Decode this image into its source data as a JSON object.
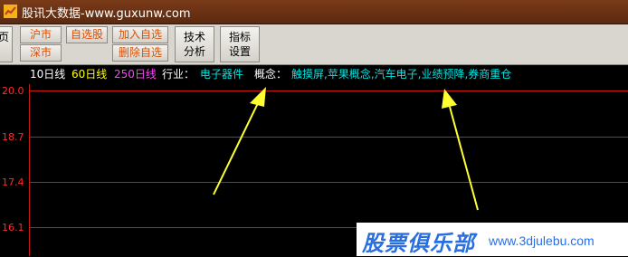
{
  "titlebar": {
    "title": "股讯大数据-www.guxunw.com"
  },
  "toolbar": {
    "page_btn": "页",
    "hushi": "沪市",
    "shenshi": "深市",
    "zixuangu": "自选股",
    "add_fav": "加入自选",
    "del_fav": "删除自选",
    "tech_analysis": [
      "技术",
      "分析"
    ],
    "indicator_settings": [
      "指标",
      "设置"
    ]
  },
  "indicator_bar": {
    "ma10": "10日线",
    "ma60": "60日线",
    "ma250": "250日线",
    "industry_label": "行业：",
    "industry_value": "电子器件",
    "concept_label": "概念：",
    "concept_value": "触摸屏,苹果概念,汽车电子,业绩预降,券商重仓"
  },
  "chart": {
    "y_ticks": [
      "20.0",
      "18.7",
      "17.4",
      "16.1"
    ]
  },
  "colors": {
    "ma10": "#ffffff",
    "ma60": "#ffff00",
    "ma250": "#ff40ff",
    "industry_value": "#00e5e5",
    "concept_value": "#00e5e5",
    "grid": "#c81818",
    "arrow": "#ffff33"
  },
  "watermark": {
    "brand": "股票俱乐部",
    "url": "www.3djulebu.com"
  }
}
